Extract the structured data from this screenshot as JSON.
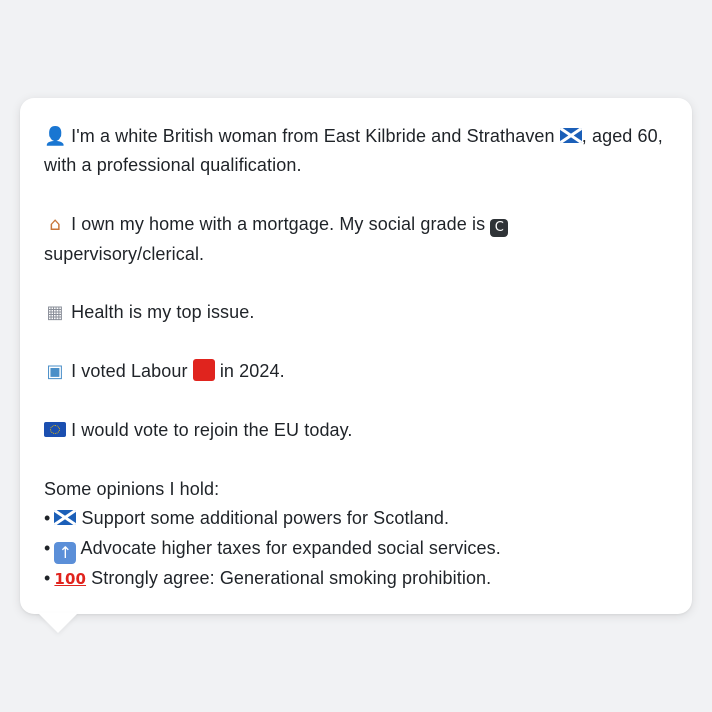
{
  "message": {
    "p1": {
      "icon": "person-icon",
      "text_a": "I'm a white British woman from East Kilbride and Strathaven",
      "flag": "scotland-flag-icon",
      "text_b": ", aged 60,",
      "line2": "with a professional qualification."
    },
    "p2": {
      "icon": "house-icon",
      "text_a": "I own my home with a mortgage. My social grade is",
      "badge": "C",
      "line2": "supervisory/clerical."
    },
    "p3": {
      "icon": "hospital-icon",
      "text": "Health is my top issue."
    },
    "p4": {
      "icon": "ballot-box-icon",
      "text_a": "I voted Labour",
      "party_color": "#e0241e",
      "text_b": "in 2024."
    },
    "p5": {
      "icon": "eu-flag-icon",
      "text": "I would vote to rejoin the EU today."
    },
    "opinions": {
      "heading": "Some opinions I hold:",
      "bullet": "•",
      "items": [
        {
          "icon": "scotland-flag-icon",
          "text": "Support some additional powers for Scotland."
        },
        {
          "icon": "up-arrow-icon",
          "text": "Advocate higher taxes for expanded social services."
        },
        {
          "icon": "hundred-points-icon",
          "text": "Strongly agree: Generational smoking prohibition.",
          "icon_text": "100"
        }
      ]
    }
  },
  "colors": {
    "background": "#f1f2f4",
    "bubble": "#ffffff",
    "text": "#1f2328"
  }
}
